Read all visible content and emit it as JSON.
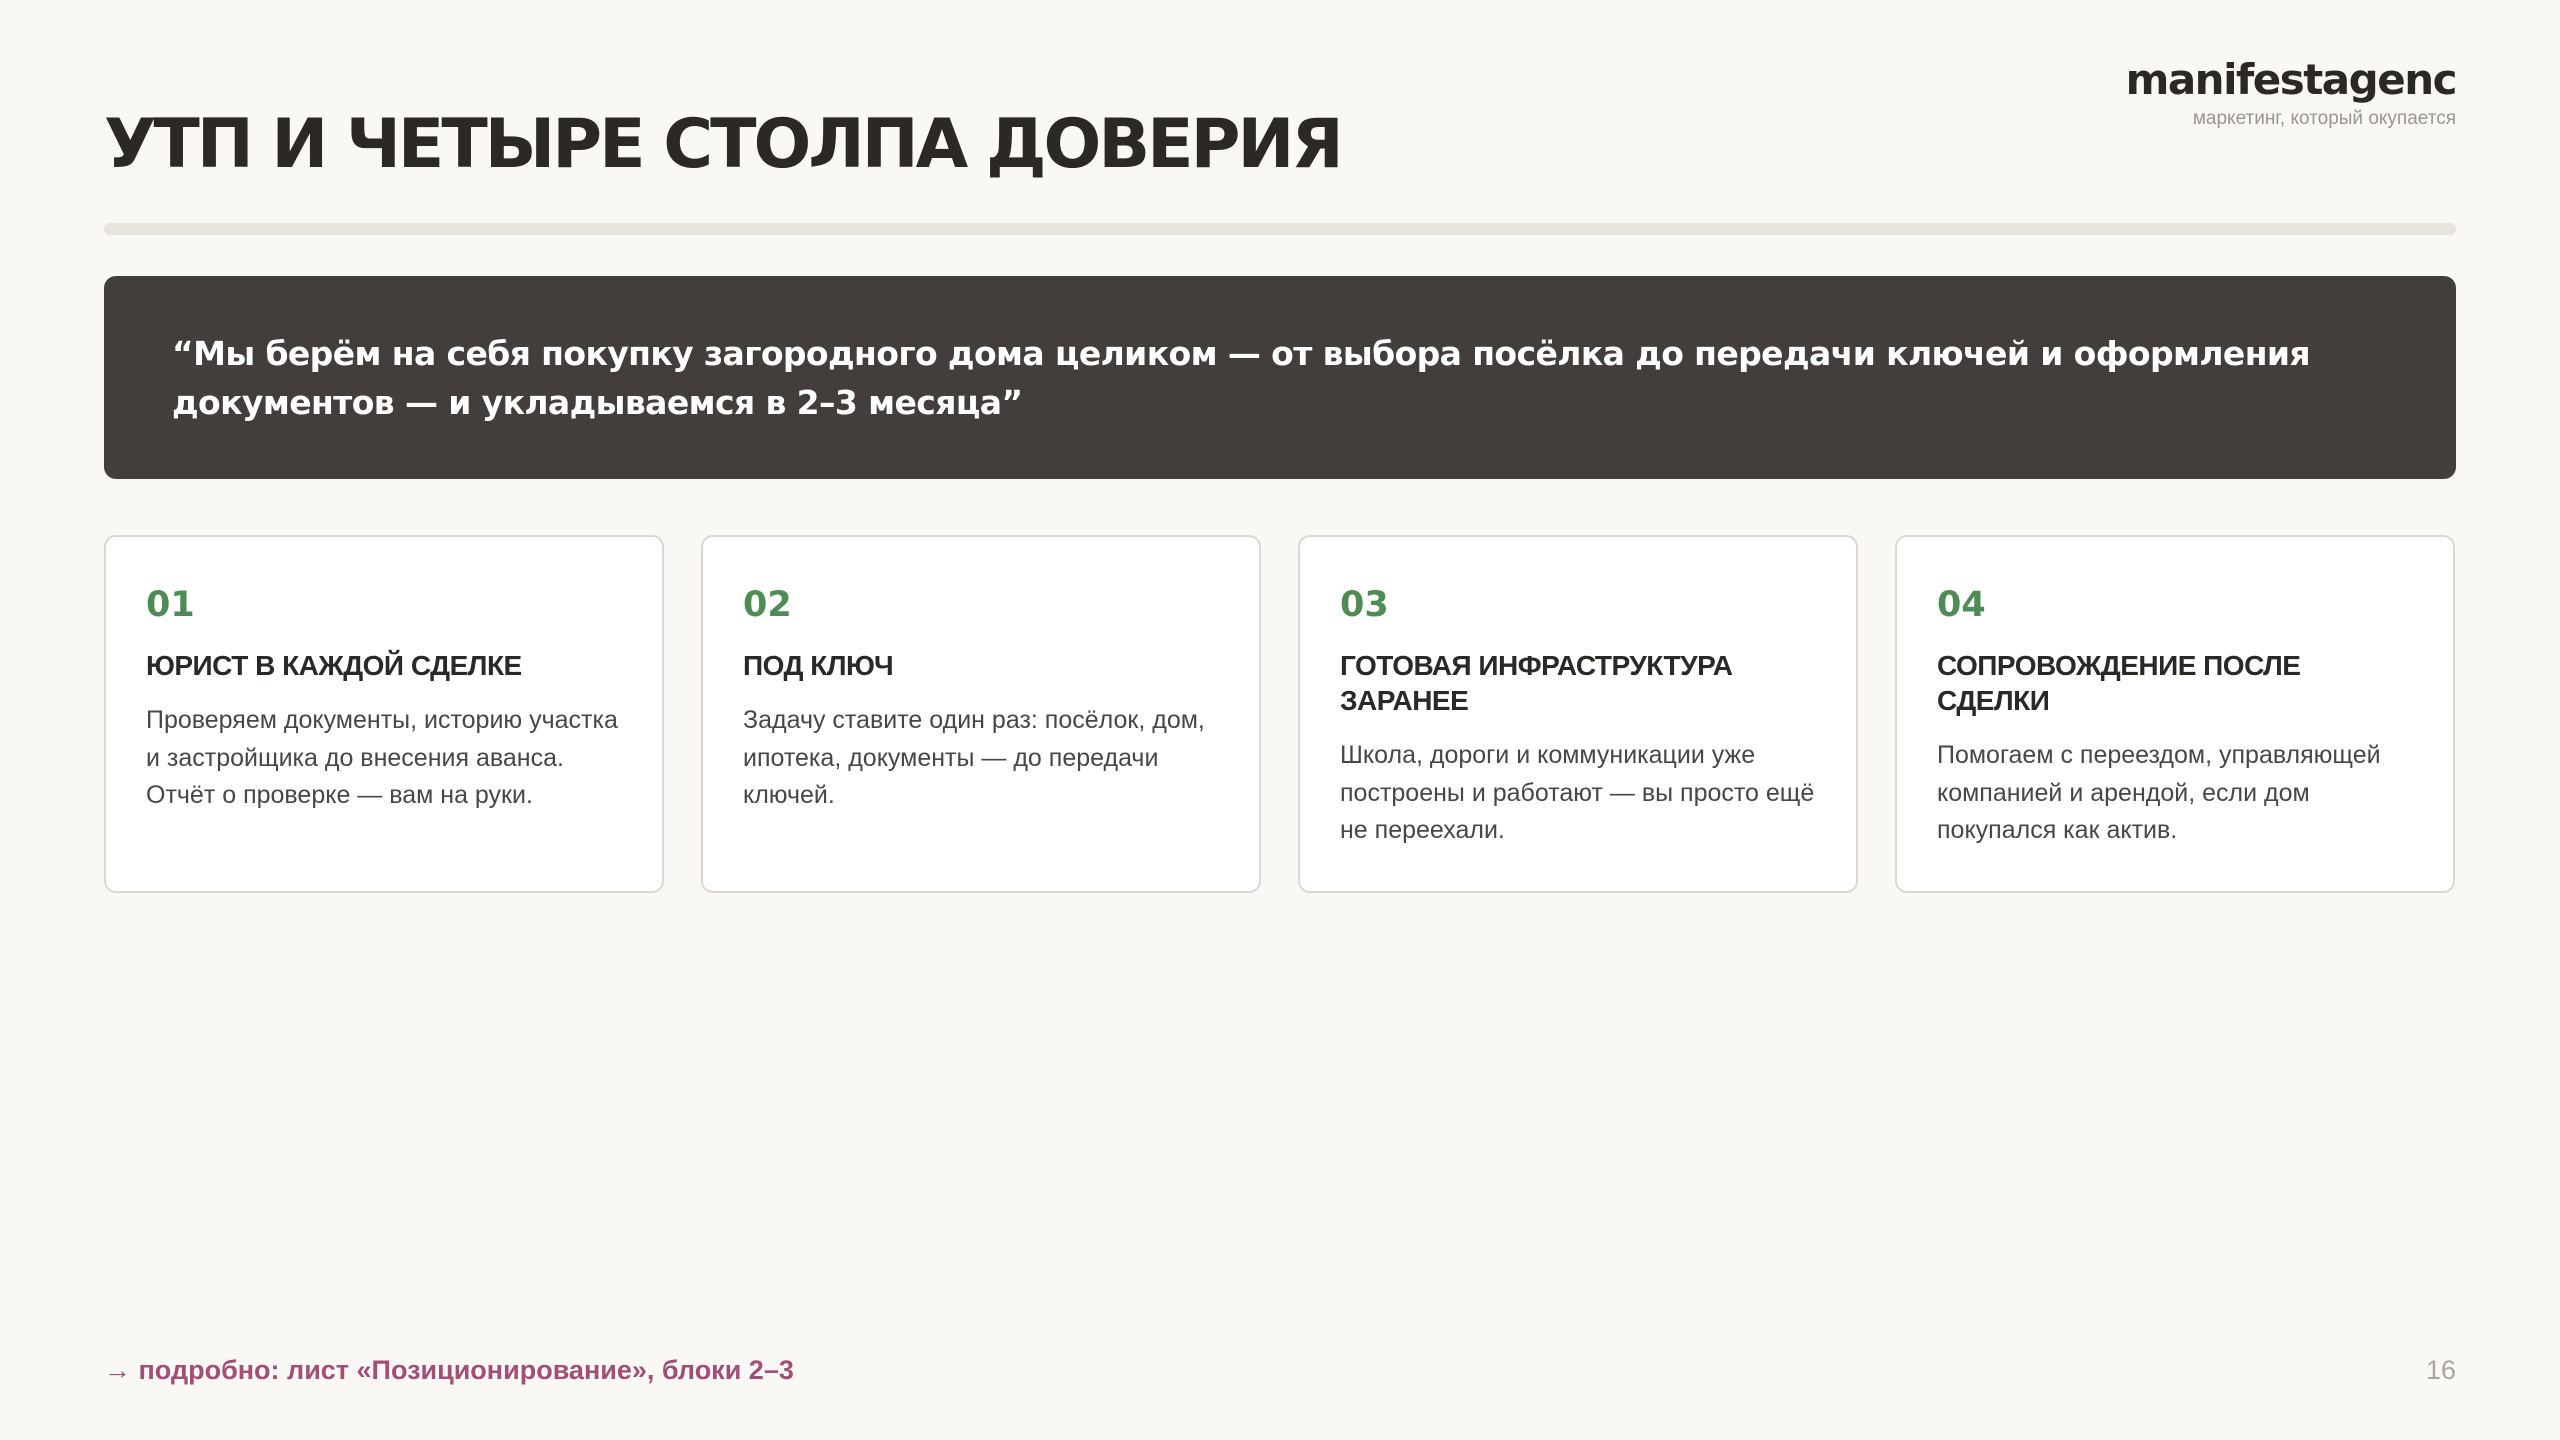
{
  "slide": {
    "title": "УТП И ЧЕТЫРЕ СТОЛПА ДОВЕРИЯ",
    "page_number": "16"
  },
  "brand": {
    "name": "manifestagenc",
    "tagline": "маркетинг, который окупается"
  },
  "usp": {
    "quote": "“Мы берём на себя покупку загородного дома целиком — от выбора посёлка до передачи ключей и оформления документов — и укладываемся в 2–3 месяца”"
  },
  "pillars": [
    {
      "number": "01",
      "title": "ЮРИСТ В КАЖДОЙ СДЕЛКЕ",
      "text": "Проверяем документы, историю участка и застройщика до внесения аванса. Отчёт о проверке — вам на руки."
    },
    {
      "number": "02",
      "title": "ПОД КЛЮЧ",
      "text": "Задачу ставите один раз: посёлок, дом, ипотека, документы — до передачи ключей."
    },
    {
      "number": "03",
      "title": "ГОТОВАЯ ИНФРАСТРУКТУРА ЗАРАНЕЕ",
      "text": "Школа, дороги и коммуникации уже построены и работают — вы просто ещё не переехали."
    },
    {
      "number": "04",
      "title": "СОПРОВОЖДЕНИЕ ПОСЛЕ СДЕЛКИ",
      "text": "Помогаем с переездом, управляющей компанией и арендой, если дом покупался как актив."
    }
  ],
  "footer": {
    "link_text": "→ подробно: лист «Позиционирование», блоки 2–3"
  },
  "colors": {
    "background": "#f9f8f5",
    "usp_background": "#433e3b",
    "accent_green": "#4f8c55",
    "link_color": "#a14f77",
    "divider": "#e9e4dc"
  }
}
